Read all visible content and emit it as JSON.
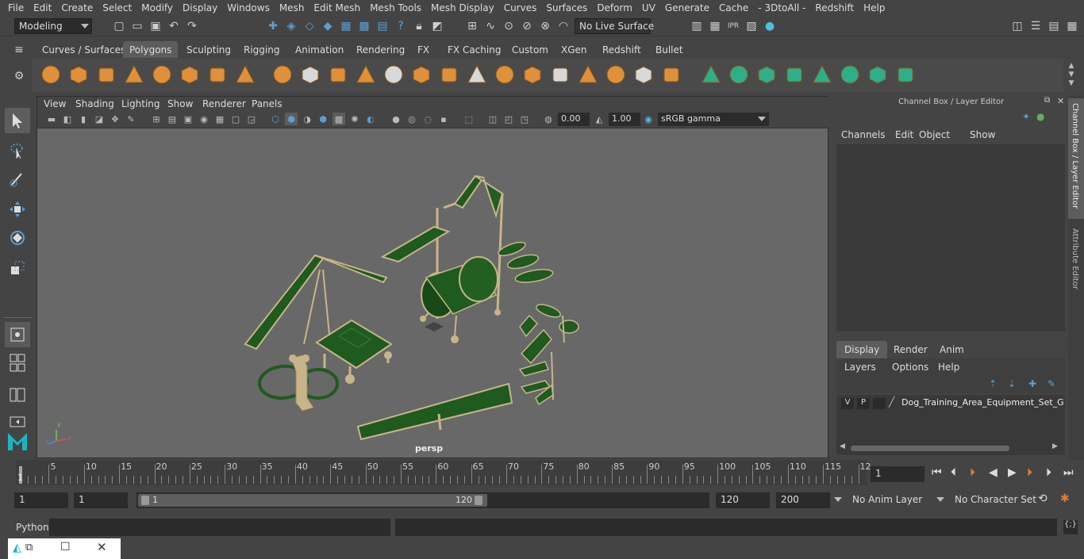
{
  "menus": [
    "File",
    "Edit",
    "Create",
    "Select",
    "Modify",
    "Display",
    "Windows",
    "Mesh",
    "Edit Mesh",
    "Mesh Tools",
    "Mesh Display",
    "Curves",
    "Surfaces",
    "Deform",
    "UV",
    "Generate",
    "Cache",
    "- 3DtoAll -",
    "Redshift",
    "Help"
  ],
  "status": {
    "mode": "Modeling",
    "live_surface": "No Live Surface"
  },
  "shelf_tabs": [
    "Curves / Surfaces",
    "Polygons",
    "Sculpting",
    "Rigging",
    "Animation",
    "Rendering",
    "FX",
    "FX Caching",
    "Custom",
    "XGen",
    "Redshift",
    "Bullet"
  ],
  "active_shelf_tab": "Polygons",
  "viewport": {
    "menus": [
      "View",
      "Shading",
      "Lighting",
      "Show",
      "Renderer",
      "Panels"
    ],
    "exposure": "0.00",
    "gamma": "1.00",
    "color_space": "sRGB gamma",
    "camera_label": "persp",
    "axis": {
      "x": "x",
      "y": "y",
      "z": "z"
    }
  },
  "channel_box": {
    "title": "Channel Box / Layer Editor",
    "menus": [
      "Channels",
      "Edit",
      "Object",
      "Show"
    ]
  },
  "layer_editor": {
    "tabs": [
      "Display",
      "Render",
      "Anim"
    ],
    "active_tab": "Display",
    "menus": [
      "Layers",
      "Options",
      "Help"
    ],
    "layer": {
      "v": "V",
      "p": "P",
      "name": "Dog_Training_Area_Equipment_Set_Gre"
    }
  },
  "side_tabs": [
    "Channel Box / Layer Editor",
    "Attribute Editor"
  ],
  "timeline": {
    "ticks": [
      "5",
      "10",
      "15",
      "20",
      "25",
      "30",
      "35",
      "40",
      "45",
      "50",
      "55",
      "60",
      "65",
      "70",
      "75",
      "80",
      "85",
      "90",
      "95",
      "100",
      "105",
      "110",
      "115",
      "12"
    ],
    "start_marker": "1",
    "current_frame": "1"
  },
  "range": {
    "start": "1",
    "playback_start": "1",
    "slider_start": "1",
    "slider_end": "120",
    "playback_end": "120",
    "end": "200",
    "anim_layer": "No Anim Layer",
    "character_set": "No Character Set"
  },
  "cmdline": {
    "label": "Python"
  },
  "colors": {
    "model_green": "#1f5a1f",
    "model_frame": "#c8b48a",
    "viewport_bg": "#686868",
    "accent": "#5a9fd4"
  }
}
